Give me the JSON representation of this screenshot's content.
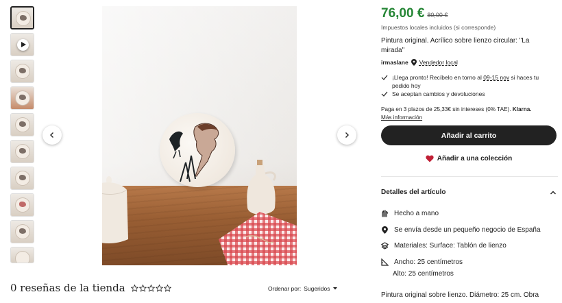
{
  "price": {
    "current": "76,00 €",
    "original": "80,00 €",
    "color": "#258635"
  },
  "taxes_note": "Impuestos locales incluidos (si corresponde)",
  "title": "Pintura original. Acrílico sobre lienzo circular: \"La mirada\"",
  "seller": {
    "name": "irmaslane",
    "badge": "Vendedor local"
  },
  "delivery": {
    "prefix": "¡Llega pronto! Recíbelo en torno al ",
    "dates": "09-15 nov",
    "suffix": " si haces tu pedido hoy"
  },
  "returns": "Se aceptan cambios y devoluciones",
  "installments": {
    "text": "Paga en 3 plazos de 25,33€ sin intereses (0% TAE). ",
    "provider": "Klarna.",
    "link": "Más información"
  },
  "buttons": {
    "add_to_cart": "Añadir al carrito",
    "add_to_collection": "Añadir a una colección"
  },
  "details": {
    "heading": "Detalles del artículo",
    "items": [
      {
        "icon": "hand-icon",
        "text": "Hecho a mano"
      },
      {
        "icon": "location-pin-icon",
        "text": "Se envía desde un pequeño negocio de España"
      },
      {
        "icon": "materials-icon",
        "text": "Materiales: Surface: Tablón de lienzo"
      },
      {
        "icon": "ruler-icon",
        "text": "Ancho: 25 centímetros"
      },
      {
        "icon": "",
        "text": "Alto: 25 centímetros"
      }
    ],
    "description_start": "Pintura original sobre lienzo. Diámetro: 25 cm. Obra"
  },
  "reviews": {
    "title": "0 reseñas de la tienda",
    "rating": 0,
    "max_rating": 5
  },
  "sort": {
    "label": "Ordenar por: ",
    "value": "Sugeridos"
  },
  "gallery": {
    "thumbnails": [
      {
        "kind": "image",
        "active": true
      },
      {
        "kind": "video",
        "active": false
      },
      {
        "kind": "image",
        "active": false
      },
      {
        "kind": "image",
        "active": false
      },
      {
        "kind": "image",
        "active": false
      },
      {
        "kind": "image",
        "active": false
      },
      {
        "kind": "image",
        "active": false
      },
      {
        "kind": "image",
        "active": false
      },
      {
        "kind": "image",
        "active": false
      },
      {
        "kind": "image",
        "active": false
      }
    ]
  }
}
